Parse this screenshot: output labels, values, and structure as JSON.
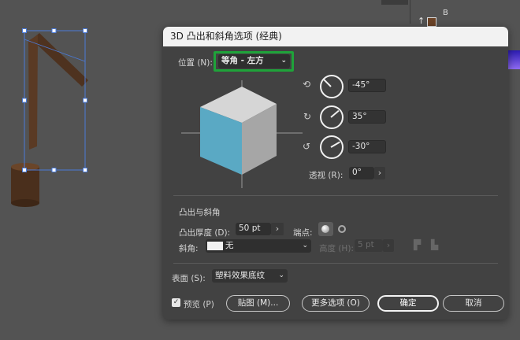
{
  "dialog": {
    "title": "3D 凸出和斜角选项 (经典)",
    "position": {
      "label": "位置 (N):",
      "value": "等角 - 左方"
    },
    "rotation": {
      "x": "-45°",
      "y": "35°",
      "z": "-30°"
    },
    "perspective": {
      "label": "透视 (R):",
      "value": "0°"
    },
    "extrude_section": {
      "title": "凸出与斜角",
      "depth_label": "凸出厚度 (D):",
      "depth_value": "50 pt",
      "cap_label": "端点:",
      "bevel_label": "斜角:",
      "bevel_value": "无",
      "height_label": "高度 (H):",
      "height_value": "5 pt"
    },
    "surface": {
      "label": "表面 (S):",
      "value": "塑料效果底纹"
    },
    "buttons": {
      "preview": "预览 (P)",
      "map_art": "贴图 (M)...",
      "more_options": "更多选项 (O)",
      "ok": "确定",
      "cancel": "取消"
    },
    "preview_checked": true
  },
  "panel": {
    "label_b": "B"
  },
  "colors": {
    "highlight": "#1fa33a",
    "cube_left": "#5aa9c4",
    "cube_top": "#d6d6d6",
    "cube_right": "#a6a6a6",
    "wood": "#5a3a24"
  }
}
